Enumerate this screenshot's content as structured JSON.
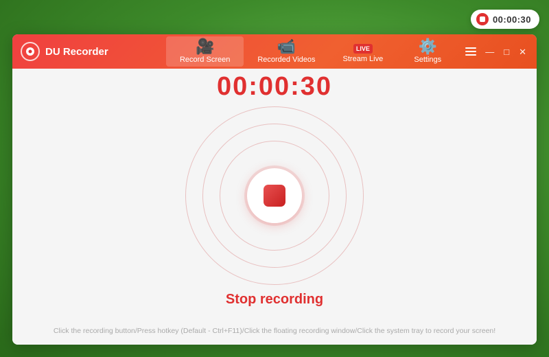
{
  "app": {
    "title": "DU Recorder"
  },
  "floating_timer": {
    "time": "00:00:30"
  },
  "nav": {
    "tabs": [
      {
        "id": "record-screen",
        "label": "Record Screen",
        "active": true
      },
      {
        "id": "recorded-videos",
        "label": "Recorded Videos",
        "active": false
      },
      {
        "id": "stream-live",
        "label": "Stream Live",
        "active": false
      },
      {
        "id": "settings",
        "label": "Settings",
        "active": false
      }
    ]
  },
  "main": {
    "timer": "00:00:30",
    "stop_label": "Stop recording",
    "hint": "Click the recording button/Press hotkey (Default - Ctrl+F11)/Click the floating recording window/Click the system tray to record your screen!"
  },
  "window_controls": {
    "menu": "☰",
    "minimize": "—",
    "maximize": "□",
    "close": "✕"
  }
}
